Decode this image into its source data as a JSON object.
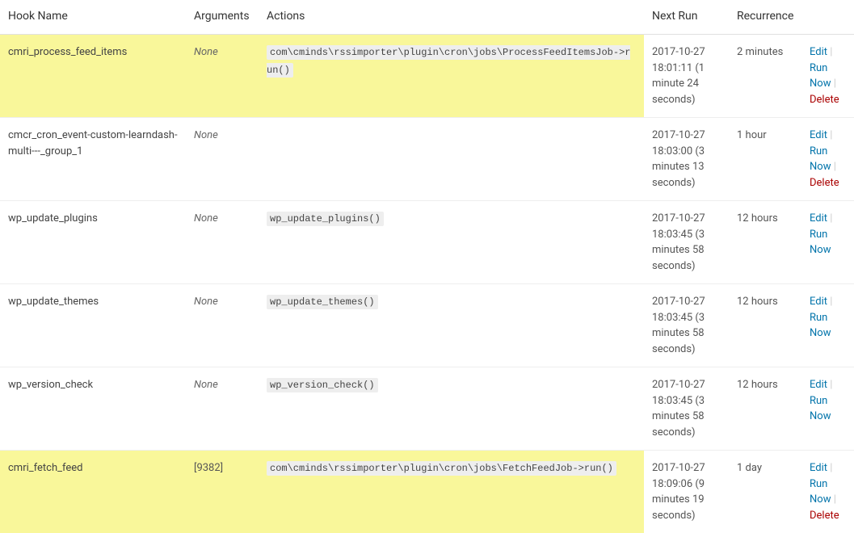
{
  "headers": {
    "hook": "Hook Name",
    "args": "Arguments",
    "actions": "Actions",
    "next": "Next Run",
    "recur": "Recurrence"
  },
  "ops": {
    "edit": "Edit",
    "run": "Run Now",
    "delete": "Delete"
  },
  "rows": [
    {
      "hook": "cmri_process_feed_items",
      "args": "None",
      "args_italic": true,
      "action": "com\\cminds\\rssimporter\\plugin\\cron\\jobs\\ProcessFeedItemsJob->run()",
      "next": "2017-10-27 18:01:11 (1 minute 24 seconds)",
      "recur": "2 minutes",
      "highlight": true,
      "show_delete": true
    },
    {
      "hook": "cmcr_cron_event-custom-learndash-multi---_group_1",
      "args": "None",
      "args_italic": true,
      "action": "",
      "next": "2017-10-27 18:03:00 (3 minutes 13 seconds)",
      "recur": "1 hour",
      "highlight": false,
      "show_delete": true
    },
    {
      "hook": "wp_update_plugins",
      "args": "None",
      "args_italic": true,
      "action": "wp_update_plugins()",
      "next": "2017-10-27 18:03:45 (3 minutes 58 seconds)",
      "recur": "12 hours",
      "highlight": false,
      "show_delete": false
    },
    {
      "hook": "wp_update_themes",
      "args": "None",
      "args_italic": true,
      "action": "wp_update_themes()",
      "next": "2017-10-27 18:03:45 (3 minutes 58 seconds)",
      "recur": "12 hours",
      "highlight": false,
      "show_delete": false
    },
    {
      "hook": "wp_version_check",
      "args": "None",
      "args_italic": true,
      "action": "wp_version_check()",
      "next": "2017-10-27 18:03:45 (3 minutes 58 seconds)",
      "recur": "12 hours",
      "highlight": false,
      "show_delete": false
    },
    {
      "hook": "cmri_fetch_feed",
      "args": "[9382]",
      "args_italic": false,
      "action": "com\\cminds\\rssimporter\\plugin\\cron\\jobs\\FetchFeedJob->run()",
      "next": "2017-10-27 18:09:06 (9 minutes 19 seconds)",
      "recur": "1 day",
      "highlight": true,
      "show_delete": true
    }
  ]
}
